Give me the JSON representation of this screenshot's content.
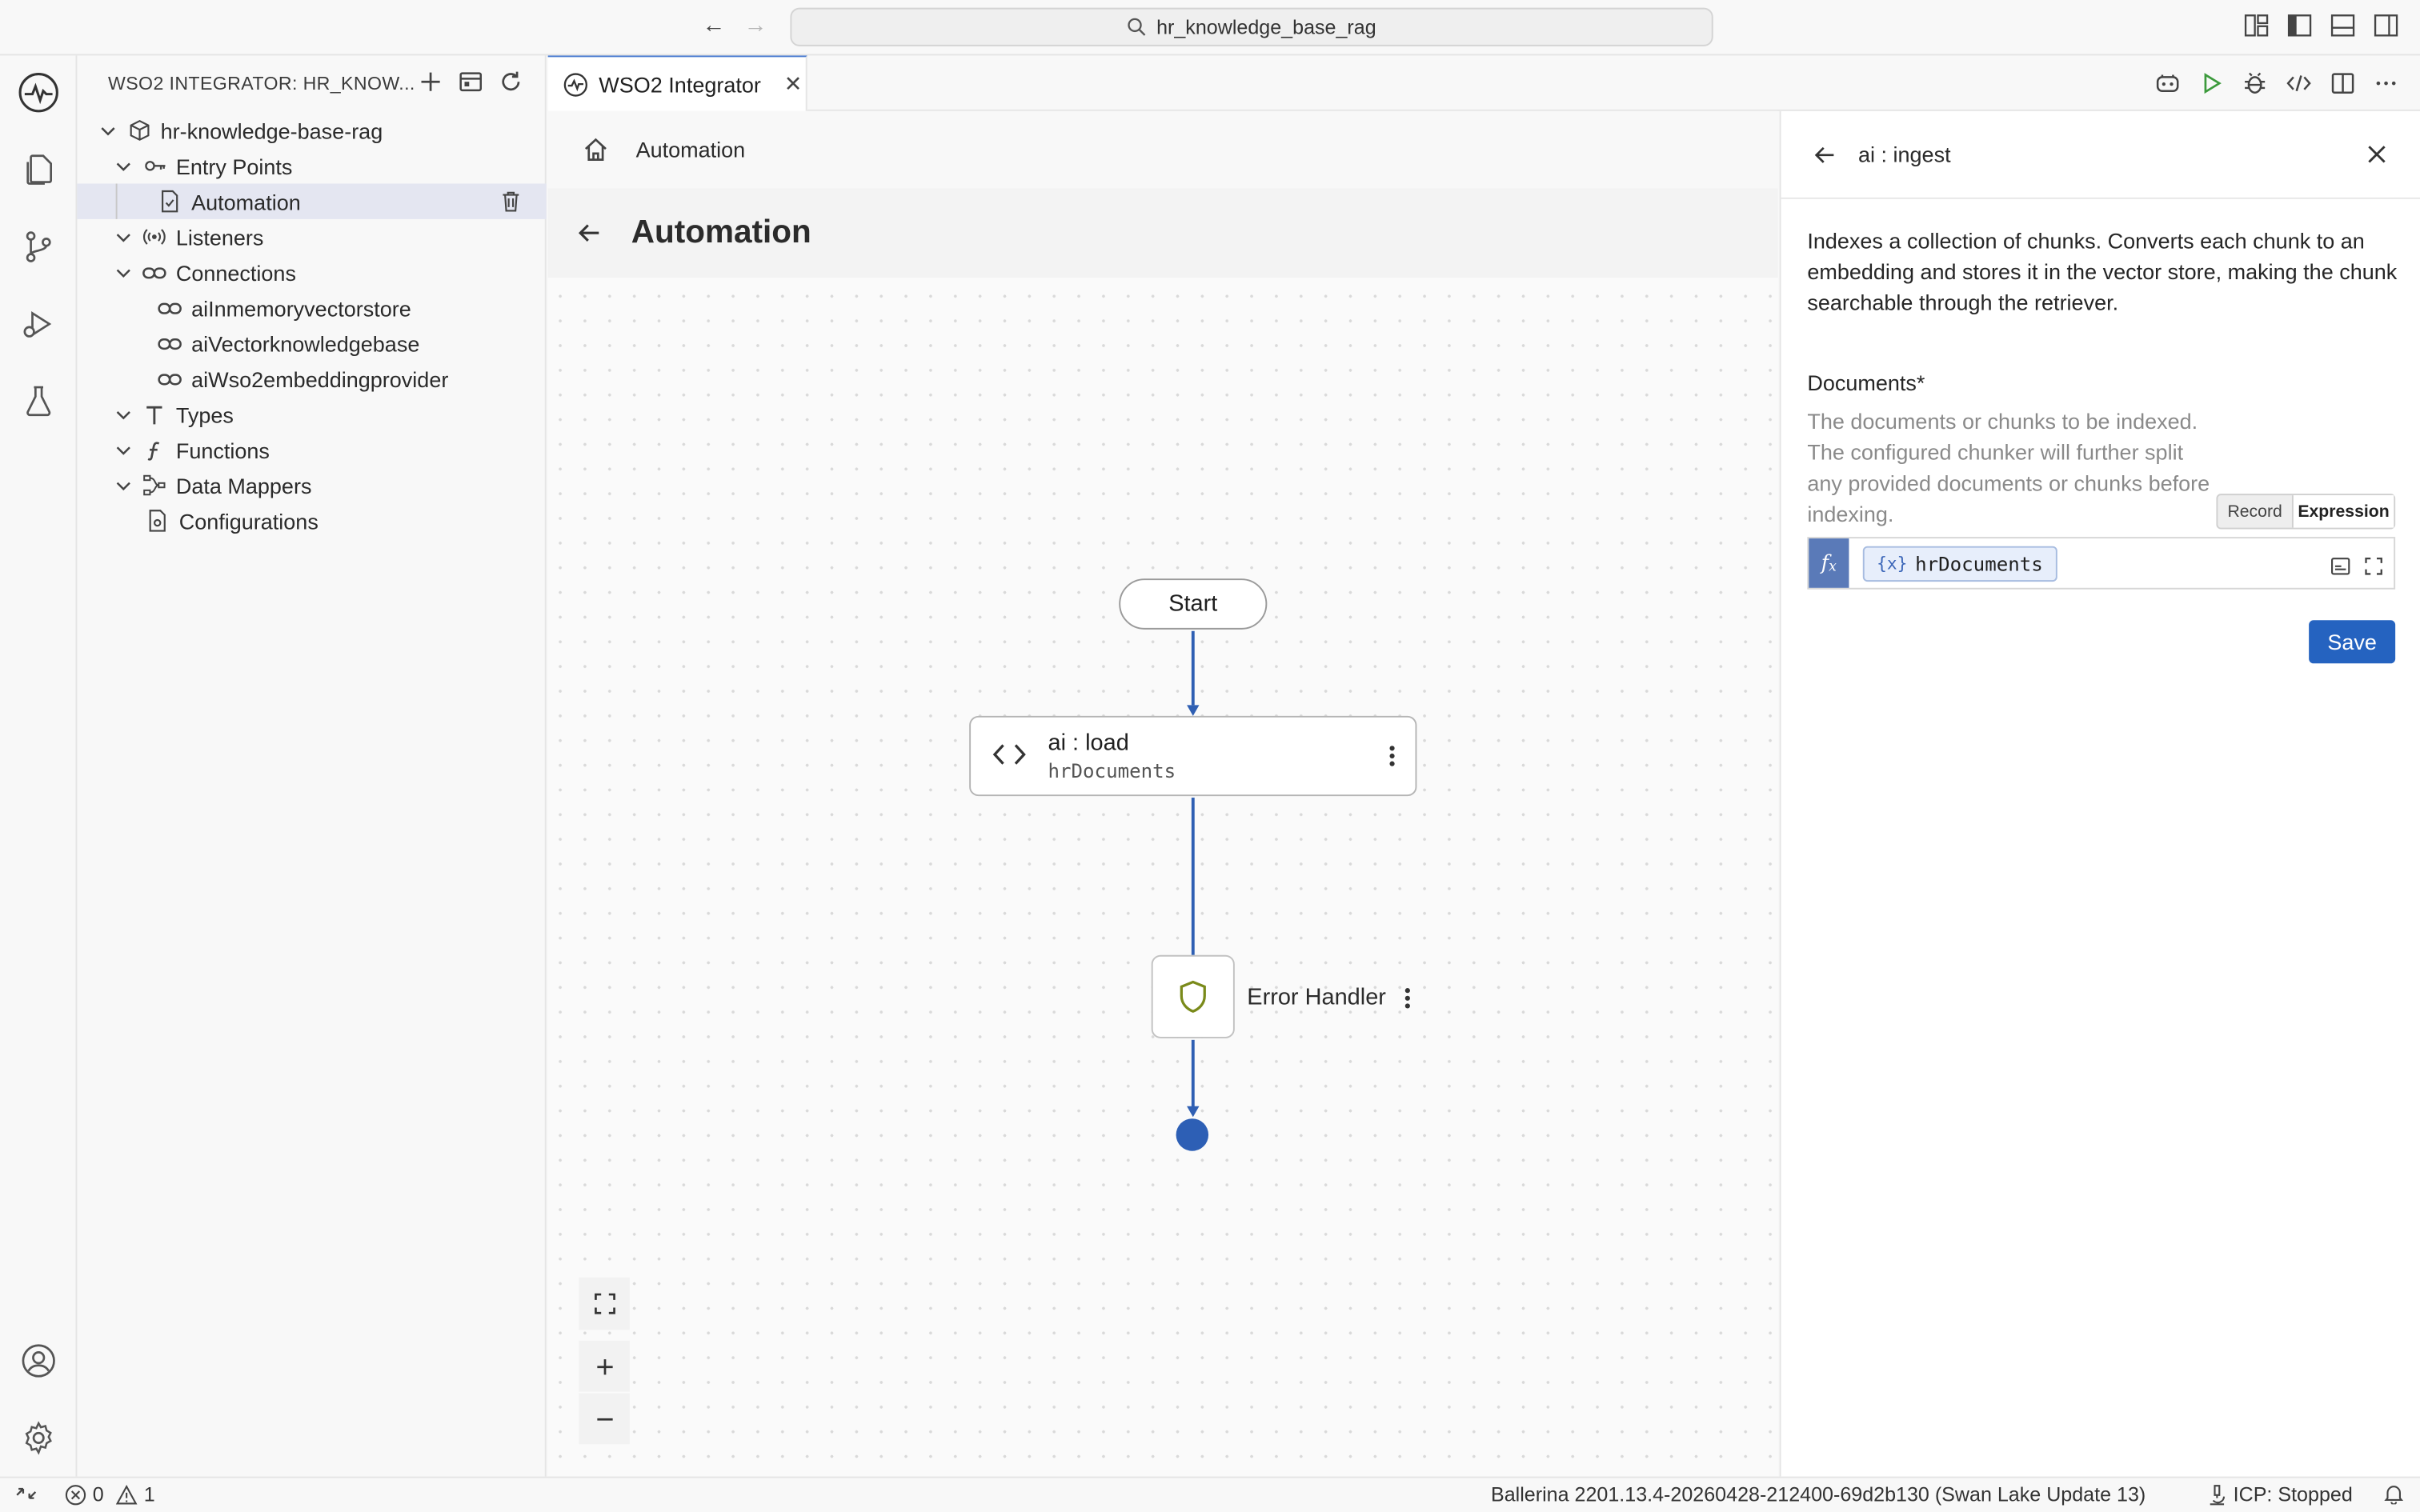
{
  "window": {
    "search_text": "hr_knowledge_base_rag"
  },
  "sidebar": {
    "title": "WSO2 INTEGRATOR: HR_KNOW...",
    "project": "hr-knowledge-base-rag",
    "items": [
      {
        "label": "Entry Points",
        "icon": "key-icon"
      },
      {
        "label": "Automation",
        "icon": "file-icon"
      },
      {
        "label": "Listeners",
        "icon": "broadcast-icon"
      },
      {
        "label": "Connections",
        "icon": "link-icon"
      },
      {
        "label": "aiInmemoryvectorstore",
        "icon": "link-icon"
      },
      {
        "label": "aiVectorknowledgebase",
        "icon": "link-icon"
      },
      {
        "label": "aiWso2embeddingprovider",
        "icon": "link-icon"
      },
      {
        "label": "Types",
        "icon": "type-icon"
      },
      {
        "label": "Functions",
        "icon": "function-icon"
      },
      {
        "label": "Data Mappers",
        "icon": "mapper-icon"
      },
      {
        "label": "Configurations",
        "icon": "settings-file-icon"
      }
    ]
  },
  "tab": {
    "label": "WSO2 Integrator"
  },
  "editor": {
    "breadcrumb": "Automation",
    "title": "Automation"
  },
  "flow": {
    "start_label": "Start",
    "load_title": "ai : load",
    "load_subtitle": "hrDocuments",
    "error_handler_label": "Error Handler"
  },
  "panel": {
    "title": "ai : ingest",
    "description": "Indexes a collection of chunks. Converts each chunk to an embedding and stores it in the vector store, making the chunk searchable through the retriever.",
    "field_label": "Documents*",
    "field_description": "The documents or chunks to be indexed. The configured chunker will further split any provided documents or chunks before indexing.",
    "mode_record": "Record",
    "mode_expression": "Expression",
    "chip_var": "{x}",
    "chip_value": "hrDocuments",
    "save_label": "Save"
  },
  "statusbar": {
    "errors": "0",
    "warnings": "1",
    "ballerina_version": "Ballerina 2201.13.4-20260428-212400-69d2b130 (Swan Lake Update 13)",
    "icp_status": "ICP: Stopped"
  },
  "colors": {
    "accent": "#2563c0",
    "flow_line": "#2f5fb3",
    "shield": "#7a8a1a"
  }
}
